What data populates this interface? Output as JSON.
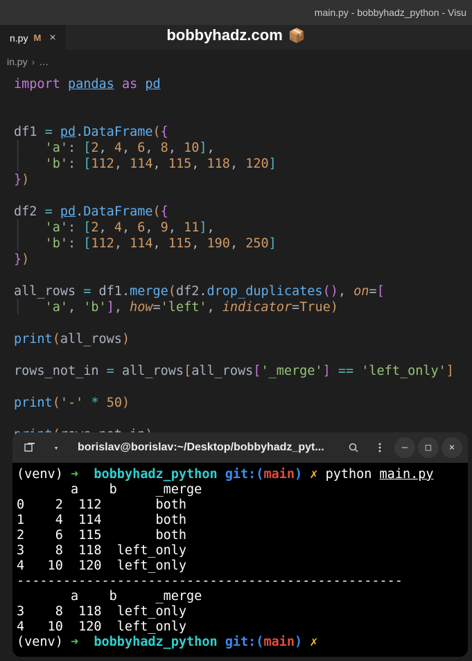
{
  "window": {
    "title": "main.py - bobbyhadz_python - Visu"
  },
  "tab": {
    "label": "n.py",
    "modified": "M",
    "close": "×"
  },
  "banner": {
    "text": "bobbyhadz.com",
    "icon": "📦"
  },
  "breadcrumb": {
    "file": "in.py",
    "sep": "›",
    "more": "…"
  },
  "code": {
    "l1_import": "import",
    "l1_pandas": "pandas",
    "l1_as": "as",
    "l1_pd": "pd",
    "l4_df1": "df1",
    "eq": "=",
    "pd": "pd",
    "dot": ".",
    "DataFrame": "DataFrame",
    "key_a": "'a'",
    "key_b": "'b'",
    "row_a1": [
      "2",
      "4",
      "6",
      "8",
      "10"
    ],
    "row_b1": [
      "112",
      "114",
      "115",
      "118",
      "120"
    ],
    "l10_df2": "df2",
    "row_a2": [
      "2",
      "4",
      "6",
      "9",
      "11"
    ],
    "row_b2": [
      "112",
      "114",
      "115",
      "190",
      "250"
    ],
    "all_rows": "all_rows",
    "df1": "df1",
    "merge": "merge",
    "df2": "df2",
    "drop_duplicates": "drop_duplicates",
    "on": "on",
    "on_list_a": "'a'",
    "on_list_b": "'b'",
    "how": "how",
    "how_val": "'left'",
    "indicator": "indicator",
    "true": "True",
    "print": "print",
    "rows_not_in": "rows_not_in",
    "merge_col": "'_merge'",
    "left_only": "'left_only'",
    "dash": "'-'",
    "star": "*",
    "fifty": "50",
    "comma": ",",
    "colon": ":",
    "lbrace": "{",
    "rbrace": "}",
    "lparen": "(",
    "rparen": ")",
    "lbrack": "[",
    "rbrack": "]",
    "double_eq": "=="
  },
  "terminal": {
    "titlebar_title": "borislav@borislav:~/Desktop/bobbyhadz_pyt...",
    "prompt_venv": "(venv)",
    "arrow": "➜",
    "dir": "bobbyhadz_python",
    "git": "git:(",
    "branch": "main",
    "git_close": ")",
    "dirty": "✗",
    "cmd_python": "python",
    "cmd_file": "main.py",
    "hdr": "       a    b     _merge",
    "r0": "0    2  112       both",
    "r1": "1    4  114       both",
    "r2": "2    6  115       both",
    "r3": "3    8  118  left_only",
    "r4": "4   10  120  left_only",
    "dashes": "--------------------------------------------------",
    "hdr2": "       a    b     _merge",
    "r3b": "3    8  118  left_only",
    "r4b": "4   10  120  left_only"
  }
}
